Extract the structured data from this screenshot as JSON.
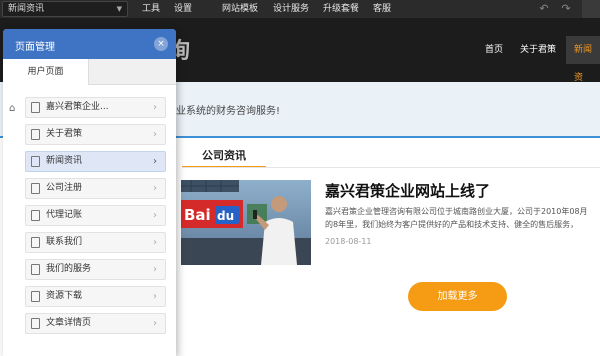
{
  "toolbar": {
    "page_select_value": "新闻资讯",
    "menu": [
      "工具",
      "设置",
      "网站模板",
      "设计服务",
      "升级套餐",
      "客服"
    ]
  },
  "header": {
    "logo_text": "询",
    "nav": [
      "首页",
      "关于君策",
      "新闻资"
    ]
  },
  "banner": {
    "text": "业系统的财务咨询服务!"
  },
  "main": {
    "section_title": "公司资讯",
    "news": {
      "title": "嘉兴君策企业网站上线了",
      "summary_line1": "嘉兴君策企业管理咨询有限公司位于城南路创业大厦，公司于2010年08月",
      "summary_line2": "的8年里，我们始终为客户提供好的产品和技术支持、健全的售后服务，",
      "date": "2018-08-11",
      "image_text": "Bai du 百度"
    },
    "load_more": "加载更多"
  },
  "panel": {
    "title": "页面管理",
    "close_label": "×",
    "tab": "用户页面",
    "items": [
      "嘉兴君策企业...",
      "关于君策",
      "新闻资讯",
      "公司注册",
      "代理记账",
      "联系我们",
      "我们的服务",
      "资源下载",
      "文章详情页"
    ],
    "selected_index": 2
  },
  "colors": {
    "panel_header": "#3f73c4",
    "accent": "#f59b14",
    "toolbar_bg": "#2b2b2b",
    "header_bg": "#1c1c1c"
  }
}
